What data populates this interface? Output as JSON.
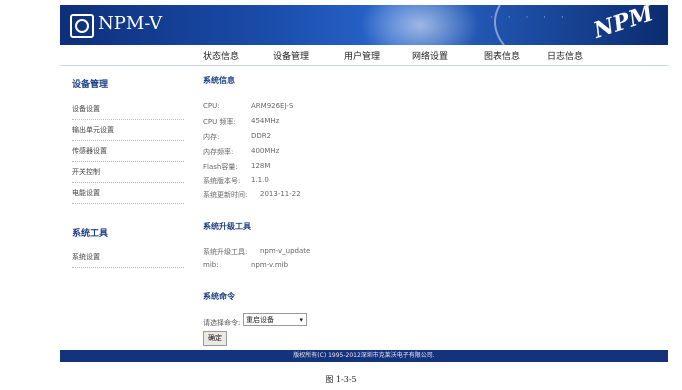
{
  "header": {
    "title": "NPM-V",
    "brand_mark": "NPM"
  },
  "nav": [
    "状态信息",
    "设备管理",
    "用户管理",
    "网络设置",
    "图表信息",
    "日志信息"
  ],
  "sidebar": {
    "device_heading": "设备管理",
    "device_items": [
      "设备设置",
      "输出单元设置",
      "传感器设置",
      "开关控制",
      "电能设置"
    ],
    "tools_heading": "系统工具",
    "tools_items": [
      "系统设置"
    ]
  },
  "main": {
    "info_title": "系统信息",
    "info_rows": [
      {
        "label": "CPU:",
        "value": "ARM926EJ-S"
      },
      {
        "label": "CPU 频率:",
        "value": "454MHz"
      },
      {
        "label": "内存:",
        "value": "DDR2"
      },
      {
        "label": "内存频率:",
        "value": "400MHz"
      },
      {
        "label": "Flash容量:",
        "value": "128M"
      },
      {
        "label": "系统版本号:",
        "value": "1.1.0"
      },
      {
        "label": "系统更新时间:",
        "value": "2013-11-22"
      }
    ],
    "upgrade_title": "系统升级工具",
    "upgrade_rows": [
      {
        "label": "系统升级工具:",
        "value": "npm-v_update"
      },
      {
        "label": "mib:",
        "value": "npm-v.mib"
      }
    ],
    "command_title": "系统命令",
    "command_label": "请选择命令:",
    "command_selected": "重启设备",
    "confirm_button": "确定"
  },
  "footer": {
    "text": "版权所有(C) 1995-2012深圳市克莱沃电子有限公司."
  },
  "caption": "图 1-3-5",
  "colors": {
    "banner": "#1a4dac",
    "heading": "#1d3f86",
    "footer": "#14337a"
  }
}
